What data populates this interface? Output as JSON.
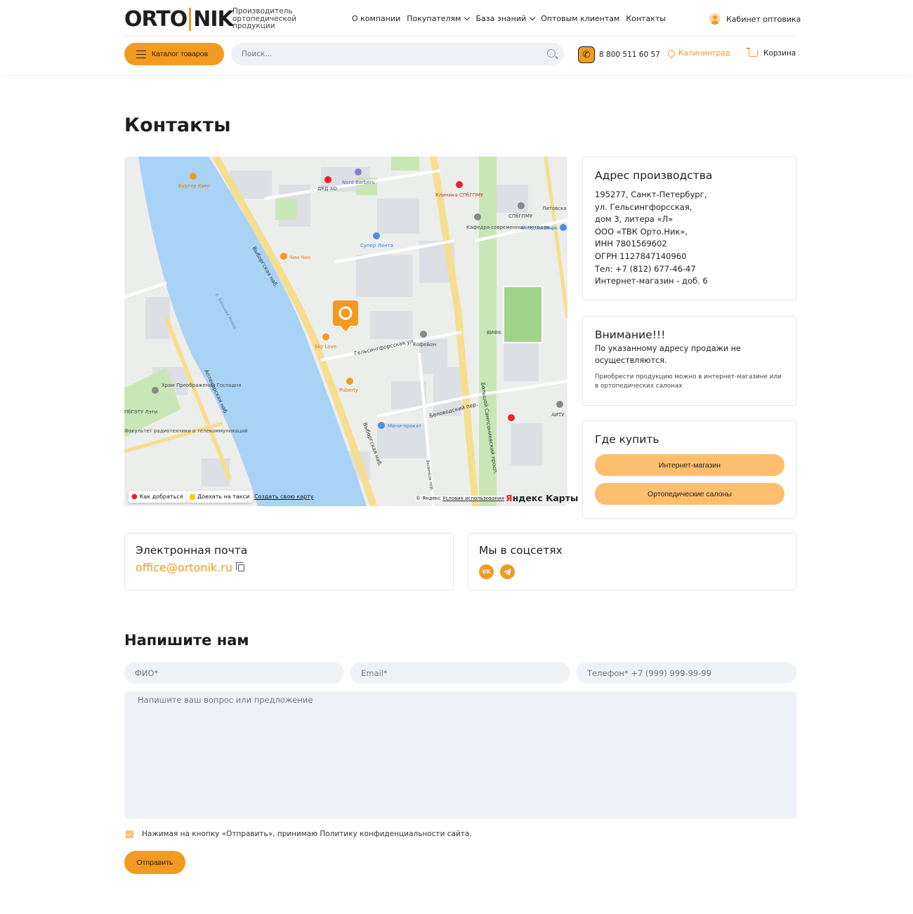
{
  "header": {
    "logo_left": "ORTO",
    "logo_right": "NIK",
    "tagline": "Производитель ортопедической продукции",
    "nav": [
      {
        "label": "О компании",
        "dropdown": false
      },
      {
        "label": "Покупателям",
        "dropdown": true
      },
      {
        "label": "База знаний",
        "dropdown": true
      },
      {
        "label": "Оптовым клиентам",
        "dropdown": false
      },
      {
        "label": "Контакты",
        "dropdown": false
      }
    ],
    "cabinet_label": "Кабинет оптовика",
    "catalog_label": "Каталог товаров",
    "search_placeholder": "Поиск...",
    "phone": "8 800 511 60 57",
    "city": "Калининград",
    "cart_label": "Корзина"
  },
  "page_title": "Контакты",
  "map": {
    "route_button": "Как добраться",
    "taxi_button": "Доехать на такси",
    "create_link": "Создать свою карту",
    "credit_prefix": "© Яндекс",
    "terms_link": "Условия использования",
    "brand_part1": "Я",
    "brand_part2": "ндекс Карты",
    "labels": {
      "burger": "Бургер Кинг",
      "ded": "ДЕД ХО",
      "nord": "Nord Barbers",
      "clinic": "Клиника СПбГПМУ",
      "spbgpmu": "СПбГПМУ",
      "litov": "Литовска",
      "basseyn": "Бассейн Вифк",
      "kafedra": "Кафедра современных методов...",
      "lenta": "Супер Лента",
      "chin": "Чин Чин",
      "river": "р. Большая Невка",
      "embank1": "Выборгская наб.",
      "embank2": "Выборгская наб.",
      "sky": "Sky Love",
      "kofe": "КофеБон",
      "helsinki": "Гельсингфорсская ул.",
      "vifk": "ВИФК",
      "hram": "Храм Преображения Господня",
      "aptek": "Аптекарская наб.",
      "puberty": "Puberty",
      "belovod": "Беловодский пер.",
      "sampson": "Большой Сампсониевский просп.",
      "mini": "Мини-прокат",
      "lti": "ПбГЭТУ Лэти",
      "fak": "Факультет радиотехники и телекоммуникаций",
      "aitu": "АИТУ",
      "zelen": "Зеленков пер."
    }
  },
  "address_card": {
    "title": "Адрес производства",
    "lines": [
      "195277, Санкт-Петербург,",
      "ул. Гельсингфорсская,",
      "дом 3, литера «Л»",
      "ООО «ТВК Орто.Ник»,",
      "ИНН 7801569602",
      "ОГРН 1127847140960",
      "Тел: +7 (812) 677-46-47",
      "Интернет-магазин - доб. 6"
    ]
  },
  "warning_card": {
    "title": "Внимание!!!",
    "bold_text": "По указанному адресу продажи не осуществляются.",
    "small_text": "Приобрести продукцию можно в интернет-магазине или в ортопедических салонах"
  },
  "buy_card": {
    "title": "Где купить",
    "btn_shop": "Интернет-магазин",
    "btn_salons": "Ортопедические салоны"
  },
  "email_card": {
    "title": "Электронная почта",
    "email": "office@ortonik.ru"
  },
  "social_card": {
    "title": "Мы в соцсетях",
    "vk": "VK"
  },
  "form": {
    "title": "Напишите нам",
    "name_placeholder": "ФИО*",
    "email_placeholder": "Email*",
    "phone_placeholder": "Телефон* +7 (999) 999-99-99",
    "message_placeholder": "Напишите ваш вопрос или предложение",
    "consent": "Нажимая на кнопку «Отправить», принимаю Политику конфиденциальности сайта.",
    "submit": "Отправить"
  },
  "colors": {
    "accent": "#f39a22",
    "accent_light": "#fdbe6e",
    "input_bg": "#eef2f7",
    "river": "#a9d3f5",
    "park": "#c9e7b6",
    "road": "#f7dd8e"
  }
}
